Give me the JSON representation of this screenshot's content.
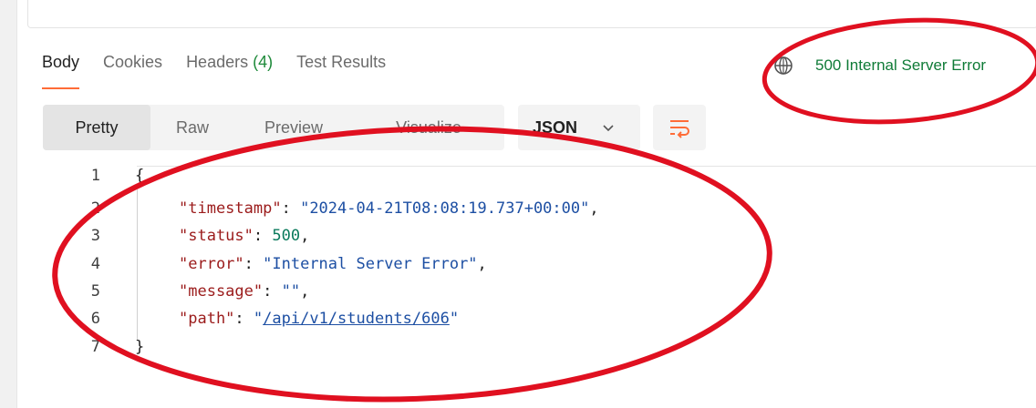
{
  "response_tabs": {
    "body": "Body",
    "cookies": "Cookies",
    "headers_label": "Headers",
    "headers_count": "(4)",
    "test_results": "Test Results"
  },
  "status": {
    "text": "500 Internal Server Error",
    "color": "#0f7b37"
  },
  "format_tabs": [
    "Pretty",
    "Raw",
    "Preview",
    "Visualize"
  ],
  "format_selected": "Pretty",
  "language_select": "JSON",
  "icons": {
    "globe": "globe-icon",
    "chevron": "chevron-down-icon",
    "wrap": "wrap-lines-icon"
  },
  "code": {
    "line_numbers": [
      "1",
      "2",
      "3",
      "4",
      "5",
      "6",
      "7"
    ],
    "open_brace": "{",
    "close_brace": "}",
    "fields": [
      {
        "key": "\"timestamp\"",
        "value": "\"2024-04-21T08:08:19.737+00:00\"",
        "suffix": ","
      },
      {
        "key": "\"status\"",
        "value": "500",
        "suffix": ","
      },
      {
        "key": "\"error\"",
        "value": "\"Internal Server Error\"",
        "suffix": ","
      },
      {
        "key": "\"message\"",
        "value": "\"\"",
        "suffix": ","
      },
      {
        "key": "\"path\"",
        "value_prefix": "\"",
        "value_link": "/api/v1/students/606",
        "value_suffix": "\"",
        "suffix": ""
      }
    ]
  },
  "colors": {
    "accent_tab": "#ff6c37",
    "annotation": "#e01020"
  }
}
